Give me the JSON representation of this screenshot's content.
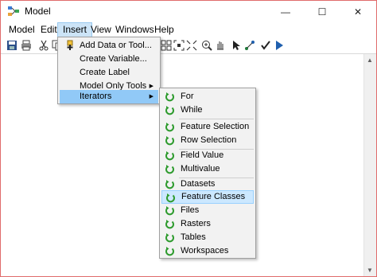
{
  "window": {
    "title": "Model",
    "minimize": "—",
    "maximize": "☐",
    "close": "✕"
  },
  "menubar": [
    "Model",
    "Edit",
    "Insert",
    "View",
    "Windows",
    "Help"
  ],
  "toolbar_icons": [
    "save-icon",
    "print-icon",
    "cut-icon",
    "copy-icon",
    "grid-icon",
    "zoom-fit-icon",
    "zoom-in-icon",
    "pan-icon",
    "select-icon",
    "connect-icon",
    "validate-icon",
    "run-icon"
  ],
  "insert_menu": {
    "items": [
      {
        "label": "Add Data or Tool...",
        "icon": "add-data-icon"
      },
      {
        "label": "Create Variable...",
        "icon": ""
      },
      {
        "label": "Create Label",
        "icon": ""
      },
      {
        "label": "Model Only Tools",
        "icon": "",
        "submenu": true
      },
      {
        "label": "Iterators",
        "icon": "",
        "submenu": true,
        "highlighted": true
      }
    ]
  },
  "iterators_menu": {
    "items": [
      {
        "label": "For"
      },
      {
        "label": "While"
      },
      {
        "label": "Feature Selection"
      },
      {
        "label": "Row Selection"
      },
      {
        "label": "Field Value"
      },
      {
        "label": "Multivalue"
      },
      {
        "label": "Datasets"
      },
      {
        "label": "Feature Classes",
        "highlighted": true
      },
      {
        "label": "Files"
      },
      {
        "label": "Rasters"
      },
      {
        "label": "Tables"
      },
      {
        "label": "Workspaces"
      }
    ],
    "icon": "iterator-icon"
  },
  "colors": {
    "iterator_green": "#2e9b2e",
    "highlight": "#cce8ff",
    "window_border": "#e06b6b"
  }
}
